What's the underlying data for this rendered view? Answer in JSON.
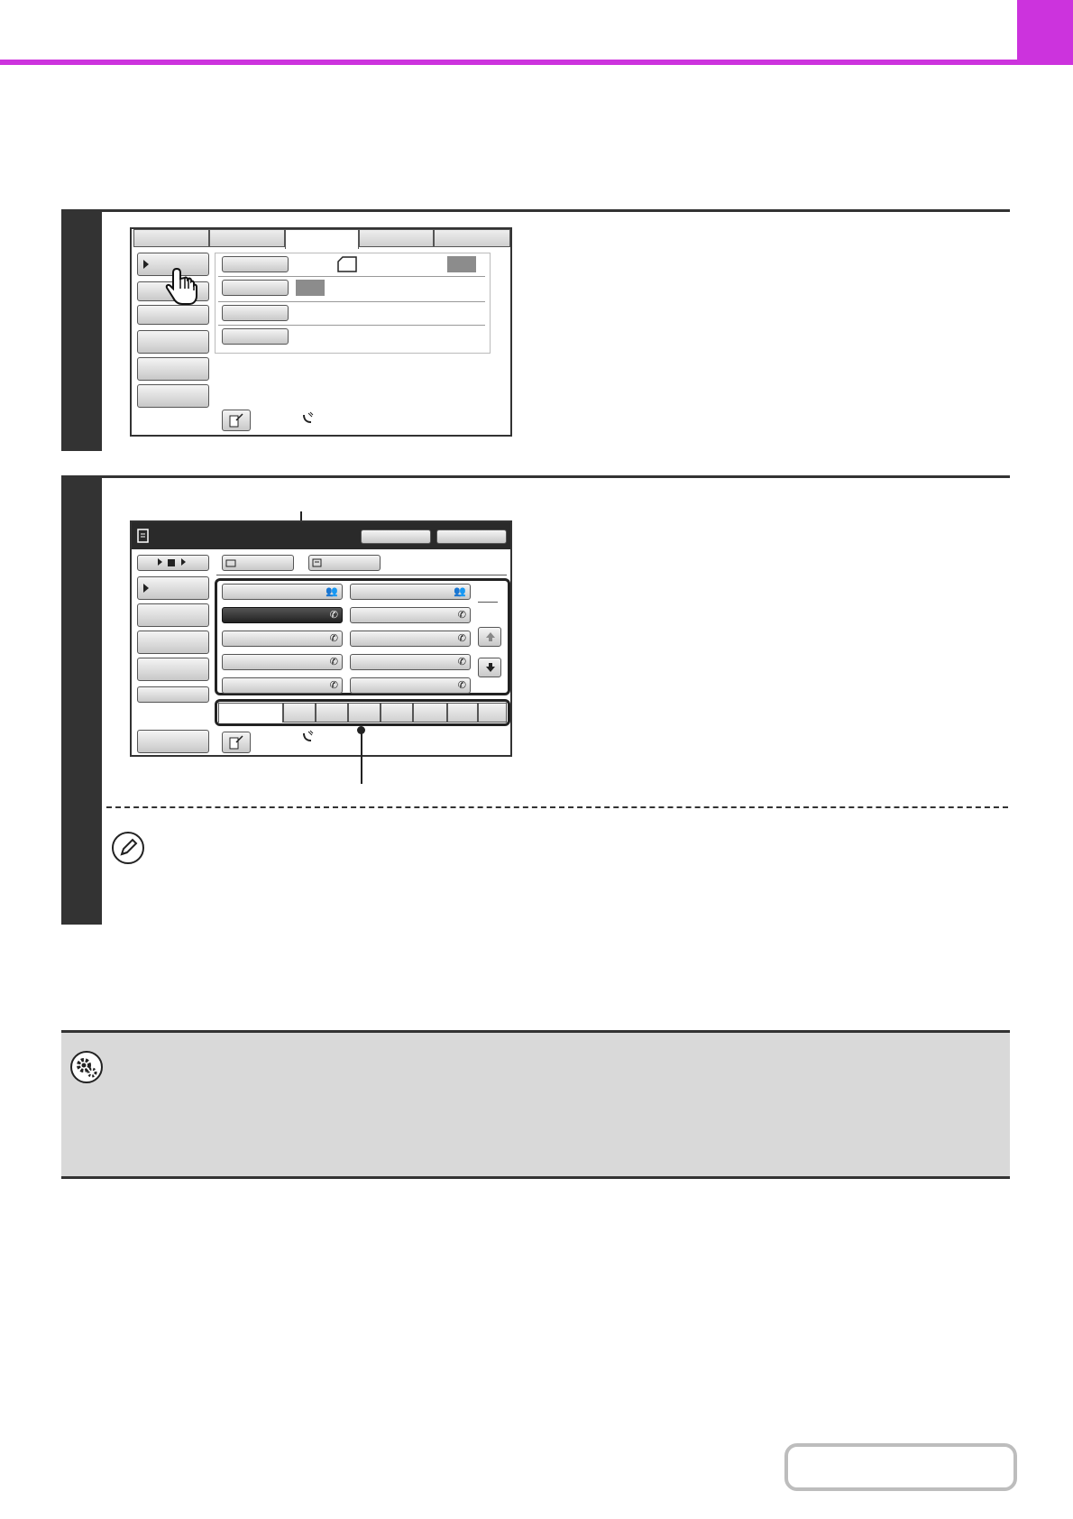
{
  "header": {
    "accent_color": "#cc33dd",
    "title": ""
  },
  "step1": {
    "number": "",
    "screen": {
      "tabs": [
        "",
        "",
        "",
        "",
        ""
      ],
      "left_buttons": [
        "",
        "",
        "",
        "",
        "",
        ""
      ],
      "rows": [
        "",
        "",
        "",
        ""
      ],
      "hand_icon": "pointing-hand-icon",
      "bottom_icon": "dial-icon"
    }
  },
  "step2": {
    "number": "",
    "screen": {
      "title_icon": "address-book-icon",
      "header_buttons": [
        "",
        ""
      ],
      "top_buttons": [
        "",
        ""
      ],
      "left_buttons": [
        "",
        "",
        "",
        "",
        "",
        ""
      ],
      "destinations": [
        {
          "icon": "group-icon"
        },
        {
          "icon": "group-icon"
        },
        {
          "icon": "phone-icon",
          "selected": true
        },
        {
          "icon": "phone-icon"
        },
        {
          "icon": "phone-icon"
        },
        {
          "icon": "phone-icon"
        },
        {
          "icon": "phone-icon"
        },
        {
          "icon": "phone-icon"
        },
        {
          "icon": "phone-icon"
        },
        {
          "icon": "phone-icon"
        }
      ],
      "scroll_icons": [
        "arrow-up-icon",
        "arrow-down-icon"
      ],
      "index_tabs": [
        "",
        "",
        "",
        "",
        "",
        "",
        "",
        "",
        ""
      ]
    },
    "note_icon": "pencil-note-icon"
  },
  "settings": {
    "icon": "system-settings-gear-icon",
    "background": "#d9d9d9"
  }
}
